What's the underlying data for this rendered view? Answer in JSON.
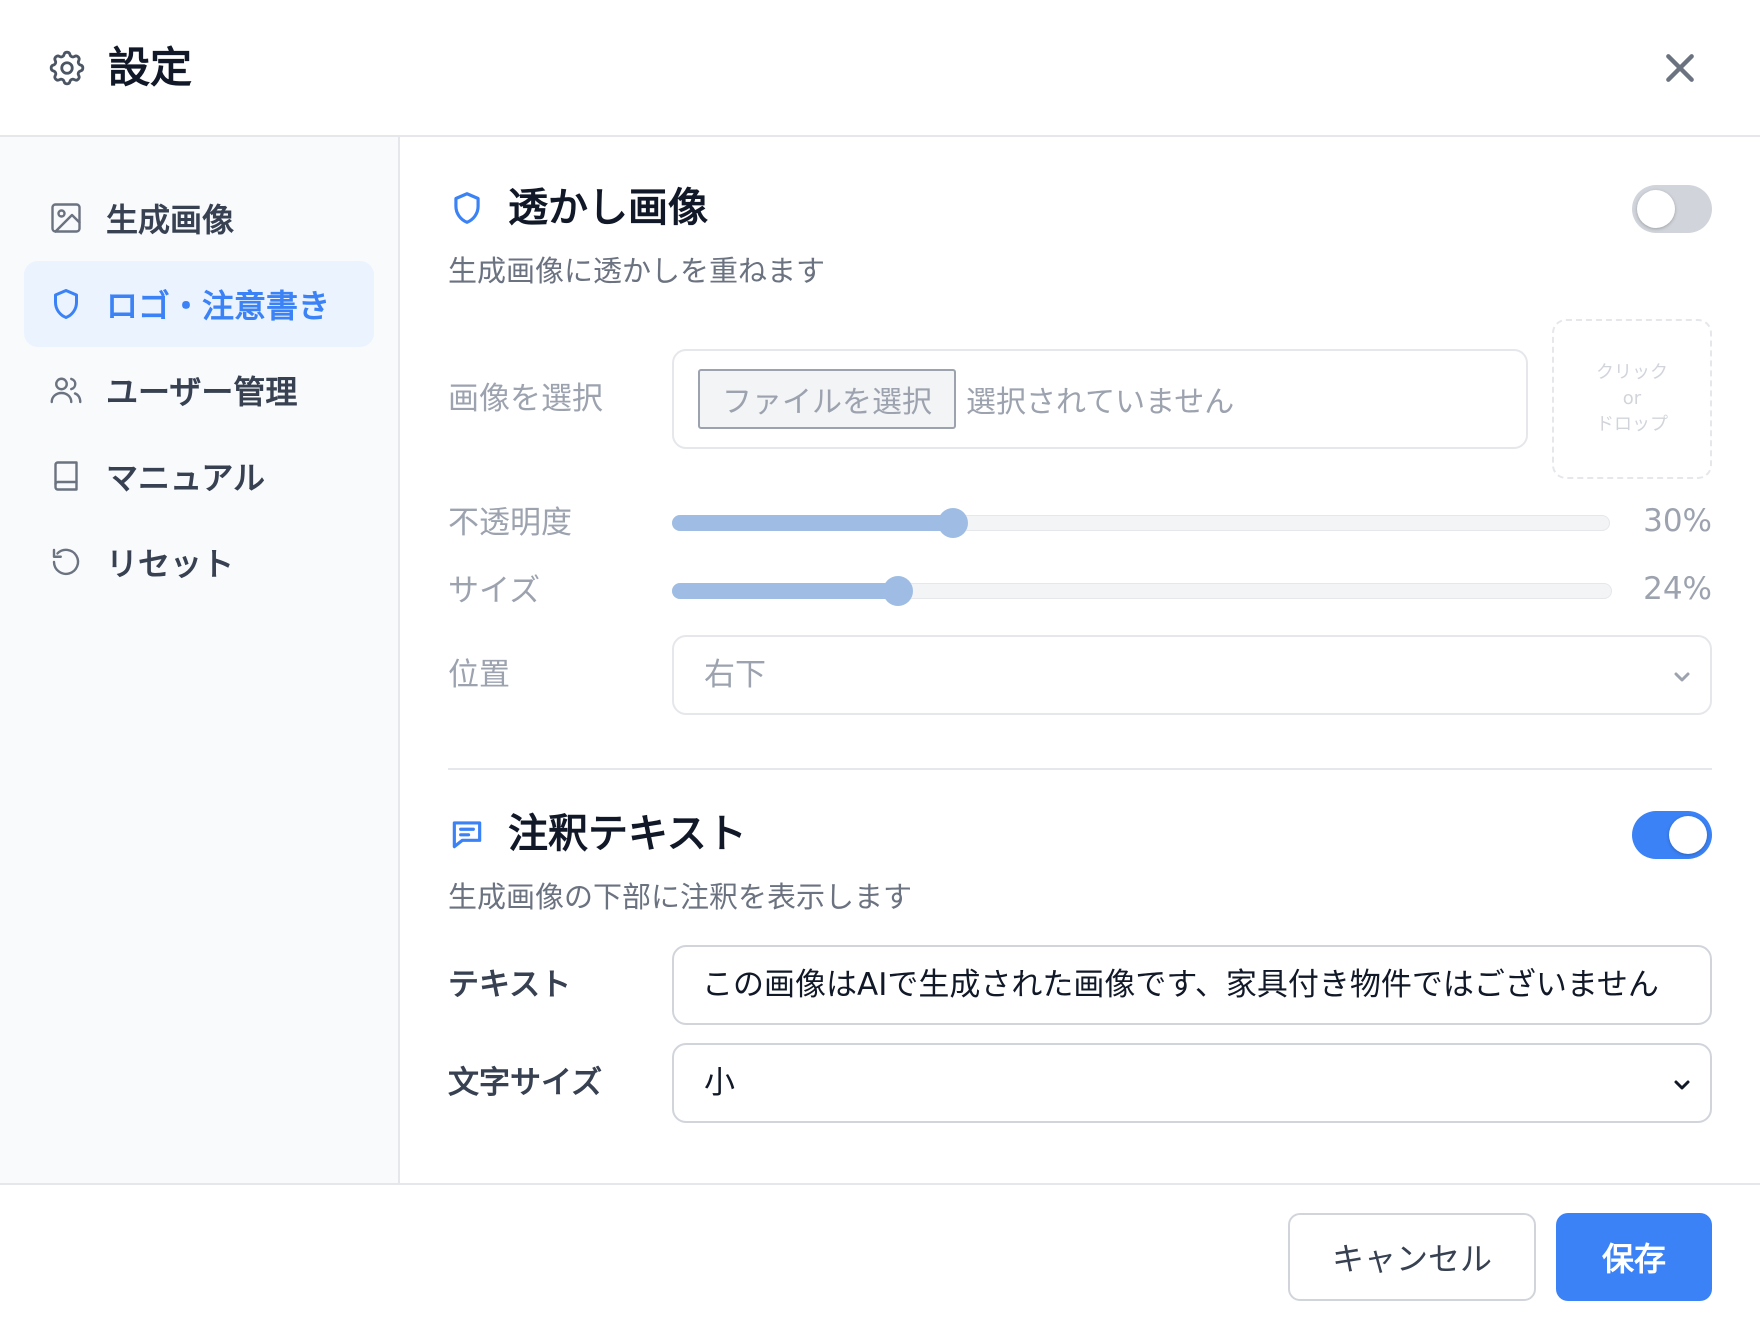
{
  "header": {
    "title": "設定",
    "icon": "gear-icon",
    "close_icon": "close-icon"
  },
  "sidebar": {
    "items": [
      {
        "label": "生成画像",
        "icon": "image-icon",
        "active": false
      },
      {
        "label": "ロゴ・注意書き",
        "icon": "shield-icon",
        "active": true
      },
      {
        "label": "ユーザー管理",
        "icon": "users-icon",
        "active": false
      },
      {
        "label": "マニュアル",
        "icon": "book-icon",
        "active": false
      },
      {
        "label": "リセット",
        "icon": "reset-icon",
        "active": false
      }
    ]
  },
  "watermark": {
    "title": "透かし画像",
    "description": "生成画像に透かしを重ねます",
    "enabled": false,
    "image_label": "画像を選択",
    "file_button": "ファイルを選択",
    "file_status": "選択されていません",
    "drop_zone": {
      "line1": "クリック",
      "line2": "or",
      "line3": "ドロップ"
    },
    "opacity_label": "不透明度",
    "opacity_value": 30,
    "opacity_text": "30%",
    "size_label": "サイズ",
    "size_value": 24,
    "size_text": "24%",
    "position_label": "位置",
    "position_value": "右下"
  },
  "annotation": {
    "title": "注釈テキスト",
    "description": "生成画像の下部に注釈を表示します",
    "enabled": true,
    "text_label": "テキスト",
    "text_value": "この画像はAIで生成された画像です、家具付き物件ではございません",
    "font_size_label": "文字サイズ",
    "font_size_value": "小"
  },
  "footer": {
    "cancel_label": "キャンセル",
    "save_label": "保存"
  },
  "colors": {
    "accent": "#3b82f6",
    "slider_fill": "#9fbde4",
    "active_nav_bg": "#eaf3fe"
  }
}
